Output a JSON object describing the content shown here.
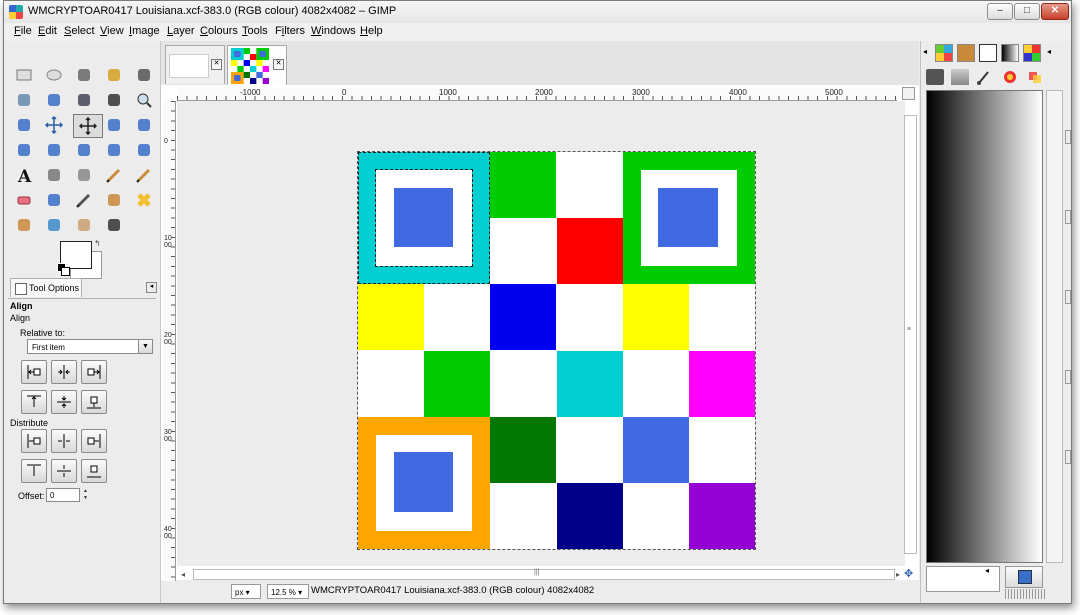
{
  "window": {
    "title": "WMCRYPTOAR0417 Louisiana.xcf-383.0 (RGB colour) 4082x4082 – GIMP",
    "minimize": "–",
    "maximize": "□",
    "close": "✕"
  },
  "menubar": {
    "items": [
      "File",
      "Edit",
      "Select",
      "View",
      "Image",
      "Layer",
      "Colours",
      "Tools",
      "Filters",
      "Windows",
      "Help"
    ],
    "mnemonics": [
      "F",
      "E",
      "S",
      "V",
      "I",
      "L",
      "C",
      "T",
      "i",
      "W",
      "H"
    ]
  },
  "toolbox": {
    "tool_icons": [
      "rect-select-icon",
      "ellipse-select-icon",
      "free-select-icon",
      "fuzzy-select-icon",
      "color-select-icon",
      "scissors-select-icon",
      "foreground-select-icon",
      "paths-icon",
      "color-picker-icon",
      "zoom-icon",
      "measure-icon",
      "move-icon",
      "align-icon",
      "crop-icon",
      "rotate-icon",
      "scale-icon",
      "shear-icon",
      "perspective-icon",
      "flip-icon",
      "cage-icon",
      "text-icon",
      "bucket-fill-icon",
      "blend-icon",
      "pencil-icon",
      "paintbrush-icon",
      "eraser-icon",
      "airbrush-icon",
      "ink-icon",
      "clone-icon",
      "heal-icon",
      "perspective-clone-icon",
      "blur-icon",
      "smudge-icon",
      "dodge-burn-icon"
    ],
    "selected_tool": "align-icon"
  },
  "tool_options": {
    "tab_label": "Tool Options",
    "heading": "Align",
    "subheading": "Align",
    "relative_to_label": "Relative to:",
    "relative_to_value": "First item",
    "distribute_label": "Distribute",
    "offset_label": "Offset:",
    "offset_value": "0"
  },
  "image_tabs": [
    {
      "name": "blank-image"
    },
    {
      "name": "qr-image"
    }
  ],
  "rulers": {
    "top_labels": [
      "-1000",
      "0",
      "1000",
      "2000",
      "3000",
      "4000",
      "5000"
    ],
    "left_labels": [
      "0",
      "1000",
      "2000",
      "3000",
      "4000"
    ]
  },
  "status": {
    "unit": "px",
    "zoom": "12.5 %",
    "text": "WMCRYPTOAR0417 Louisiana.xcf-383.0 (RGB colour) 4082x4082"
  },
  "image_colors": {
    "cyan": "#00CED1",
    "green": "#00CC00",
    "orange": "#FFA500",
    "royal_blue": "#4169E1",
    "red": "#FF0000",
    "yellow": "#FFFF00",
    "blue": "#0000EE",
    "magenta": "#FF00FF",
    "dark_green": "#007700",
    "navy": "#000088",
    "purple": "#9400D3"
  },
  "dock": {
    "panel": "gradient-panel"
  }
}
